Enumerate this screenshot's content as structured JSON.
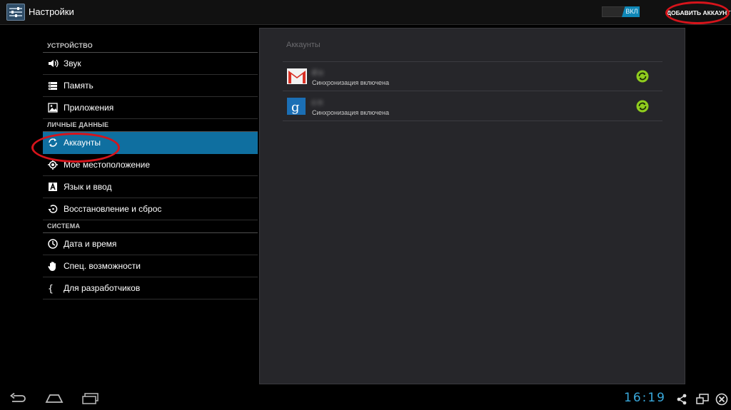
{
  "actionbar": {
    "title": "Настройки",
    "switch_label": "ВКЛ",
    "add_account_label": "ДОБАВИТЬ АККАУНТ"
  },
  "sections": [
    {
      "header": "УСТРОЙСТВО",
      "items": [
        {
          "label": "Звук",
          "icon": "volume-icon"
        },
        {
          "label": "Память",
          "icon": "storage-icon"
        },
        {
          "label": "Приложения",
          "icon": "apps-icon"
        }
      ]
    },
    {
      "header": "ЛИЧНЫЕ ДАННЫЕ",
      "items": [
        {
          "label": "Аккаунты",
          "icon": "sync-icon",
          "selected": true
        },
        {
          "label": "Мое местоположение",
          "icon": "location-icon"
        },
        {
          "label": "Язык и ввод",
          "icon": "keyboard-a-icon"
        },
        {
          "label": "Восстановление и сброс",
          "icon": "backup-restore-icon"
        }
      ]
    },
    {
      "header": "СИСТЕМА",
      "items": [
        {
          "label": "Дата и время",
          "icon": "clock-icon"
        },
        {
          "label": "Спец. возможности",
          "icon": "hand-icon"
        },
        {
          "label": "Для разработчиков",
          "icon": "braces-icon"
        }
      ]
    }
  ],
  "accounts_panel": {
    "title": "Аккаунты",
    "accounts": [
      {
        "name": "d                              u",
        "status": "Синхронизация включена",
        "icon": "gmail-icon"
      },
      {
        "name": "c                              n",
        "status": "Синхронизация включена",
        "icon": "google-icon"
      }
    ]
  },
  "navbar": {
    "clock": "16:19"
  },
  "colors": {
    "accent": "#0f6fa0",
    "switch_on": "#0f87b7",
    "sync_green": "#8fcc1e",
    "highlight_ring": "#d6141b",
    "clock": "#39a9dc"
  }
}
